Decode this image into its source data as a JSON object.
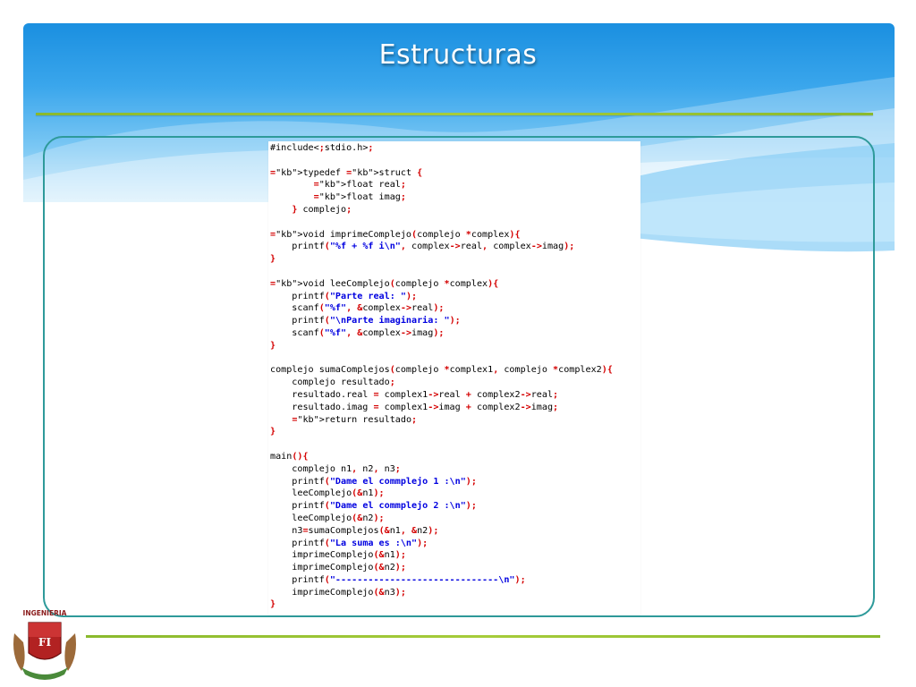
{
  "slide": {
    "title": "Estructuras"
  },
  "logo": {
    "text": "INGENIERIA",
    "monogram": "FI"
  },
  "code": {
    "language": "c",
    "lines": [
      "#include<stdio.h>",
      "",
      "typedef struct {",
      "        float real;",
      "        float imag;",
      "    } complejo;",
      "",
      "void imprimeComplejo(complejo *complex){",
      "    printf(\"%f + %f i\\n\", complex->real, complex->imag);",
      "}",
      "",
      "void leeComplejo(complejo *complex){",
      "    printf(\"Parte real: \");",
      "    scanf(\"%f\", &complex->real);",
      "    printf(\"\\nParte imaginaria: \");",
      "    scanf(\"%f\", &complex->imag);",
      "}",
      "",
      "complejo sumaComplejos(complejo *complex1, complejo *complex2){",
      "    complejo resultado;",
      "    resultado.real = complex1->real + complex2->real;",
      "    resultado.imag = complex1->imag + complex2->imag;",
      "    return resultado;",
      "}",
      "",
      "main(){",
      "    complejo n1, n2, n3;",
      "    printf(\"Dame el commplejo 1 :\\n\");",
      "    leeComplejo(&n1);",
      "    printf(\"Dame el commplejo 2 :\\n\");",
      "    leeComplejo(&n2);",
      "    n3=sumaComplejos(&n1, &n2);",
      "    printf(\"La suma es :\\n\");",
      "    imprimeComplejo(&n1);",
      "    imprimeComplejo(&n2);",
      "    printf(\"------------------------------\\n\");",
      "    imprimeComplejo(&n3);",
      "}"
    ]
  },
  "colors": {
    "header_blue": "#1a8fe0",
    "rule_green": "#a6cc3a",
    "frame_teal": "#2e9a9a",
    "string_blue": "#0000e0",
    "operator_red": "#d40000"
  }
}
